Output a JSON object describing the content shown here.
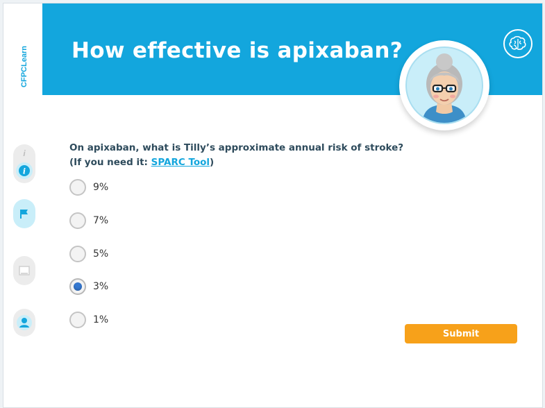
{
  "brand": {
    "name": "CFPCLearn"
  },
  "header": {
    "title": "How effective is apixaban?",
    "brain_icon": "brain-icon"
  },
  "sidebar": {
    "info_icon": "info-icon",
    "flag_icon": "flag-icon",
    "notes_icon": "notes-icon",
    "profile_icon": "profile-icon"
  },
  "question": {
    "text": "On apixaban, what is Tilly’s approximate annual risk of stroke?",
    "hint_prefix": "(If you need it: ",
    "link_text": "SPARC Tool",
    "hint_suffix": ")"
  },
  "options": [
    {
      "label": "9%",
      "selected": false
    },
    {
      "label": "7%",
      "selected": false
    },
    {
      "label": "5%",
      "selected": false
    },
    {
      "label": "3%",
      "selected": true
    },
    {
      "label": "1%",
      "selected": false
    }
  ],
  "submit_label": "Submit",
  "colors": {
    "header": "#13a6dd",
    "submit": "#f7a11a",
    "selected_dot": "#3578d0"
  }
}
